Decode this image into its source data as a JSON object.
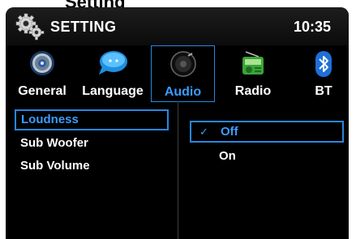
{
  "bezel": {
    "partial_text": "Setting"
  },
  "header": {
    "title": "SETTING",
    "time": "10:35",
    "icon": "gears-icon"
  },
  "tabs": [
    {
      "label": "General",
      "icon": "gear-icon",
      "active": false
    },
    {
      "label": "Language",
      "icon": "speech-bubble-icon",
      "active": false
    },
    {
      "label": "Audio",
      "icon": "speaker-icon",
      "active": true
    },
    {
      "label": "Radio",
      "icon": "radio-icon",
      "active": false
    },
    {
      "label": "BT",
      "icon": "bluetooth-icon",
      "active": false
    }
  ],
  "menu": {
    "items": [
      {
        "label": "Loudness",
        "selected": true
      },
      {
        "label": "Sub Woofer",
        "selected": false
      },
      {
        "label": "Sub Volume",
        "selected": false
      }
    ]
  },
  "options": {
    "items": [
      {
        "label": "Off",
        "selected": true,
        "check": "✓"
      },
      {
        "label": "On",
        "selected": false,
        "check": ""
      }
    ]
  },
  "colors": {
    "accent": "#2a86e0",
    "accent_text": "#3b9cff",
    "background": "#000000",
    "text": "#ffffff"
  }
}
